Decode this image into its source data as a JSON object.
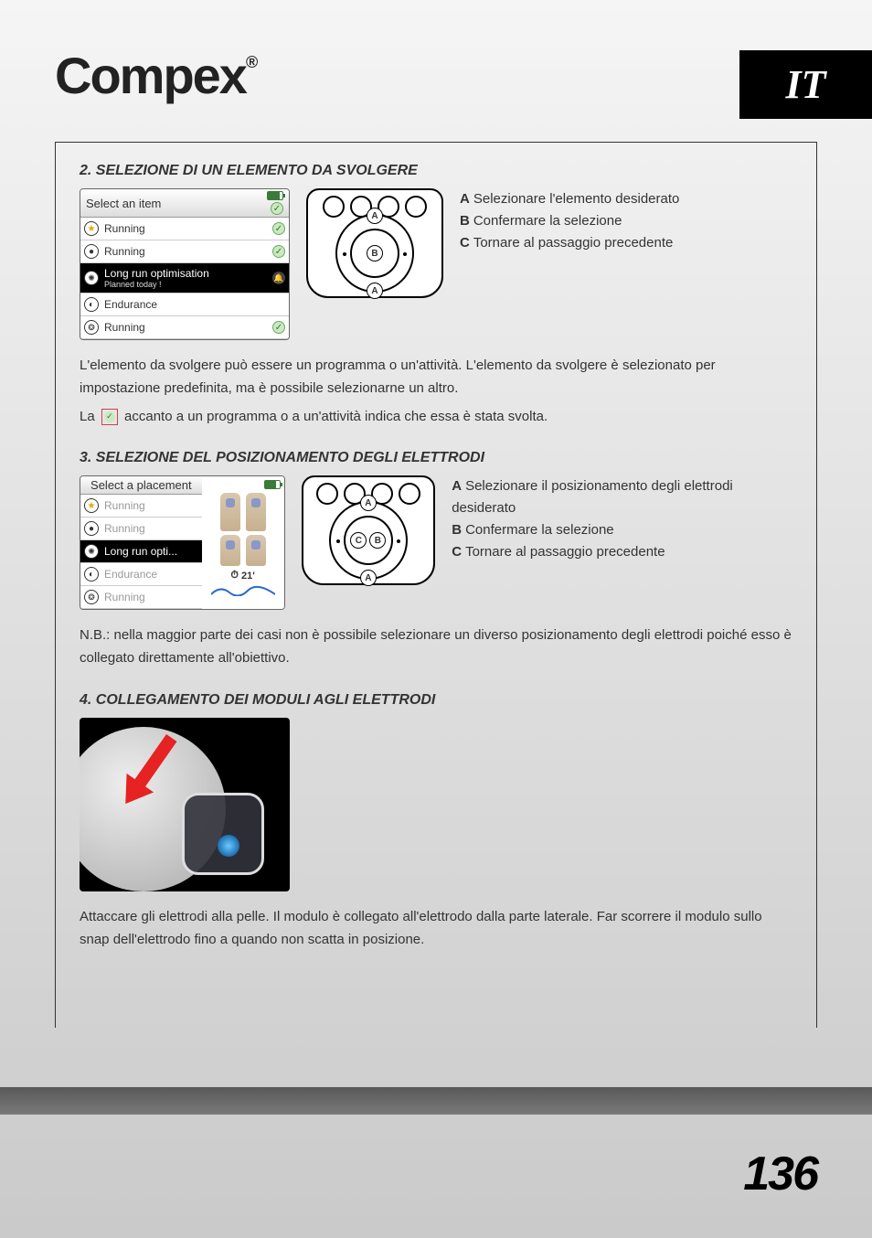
{
  "brand": "Compex",
  "registered": "®",
  "language_tab": "IT",
  "page_number": "136",
  "section2": {
    "title": "2.  SELEZIONE DI UN ELEMENTO DA SVOLGERE",
    "screen_header": "Select an item",
    "items": [
      {
        "label": "Running",
        "checked": true
      },
      {
        "label": "Running",
        "checked": true
      },
      {
        "label": "Long run optimisation",
        "sub": "Planned today !",
        "selected": true,
        "bell": true
      },
      {
        "label": "Endurance"
      },
      {
        "label": "Running",
        "checked": true
      }
    ],
    "instructions": {
      "A": "Selezionare l'elemento desiderato",
      "B": "Confermare la selezione",
      "C": "Tornare al passaggio precedente"
    },
    "para1": "L'elemento da svolgere può essere un programma o un'attività. L'elemento da svolgere è selezionato per impostazione predefinita, ma è possibile selezionarne un altro.",
    "para2_pre": "La",
    "para2_post": "accanto a un programma o a un'attività indica che essa è stata svolta."
  },
  "section3": {
    "title": "3.  SELEZIONE DEL POSIZIONAMENTO DEGLI ELETTRODI",
    "screen_header": "Select a placement",
    "items": [
      {
        "label": "Running"
      },
      {
        "label": "Running"
      },
      {
        "label": "Long run opti...",
        "selected": true
      },
      {
        "label": "Endurance"
      },
      {
        "label": "Running"
      }
    ],
    "timer": "21'",
    "instructions": {
      "A": "Selezionare il posizionamento degli elettrodi desiderato",
      "B": "Confermare la selezione",
      "C": "Tornare al passaggio precedente"
    },
    "note": "N.B.: nella maggior parte dei casi non è possibile selezionare un diverso posizionamento degli elettrodi poiché esso è collegato direttamente all'obiettivo."
  },
  "section4": {
    "title": "4.  COLLEGAMENTO DEI MODULI AGLI ELETTRODI",
    "para": "Attaccare gli elettrodi alla pelle. Il modulo è collegato all'elettrodo dalla parte laterale. Far scorrere il modulo sullo snap dell'elettrodo fino a quando non scatta in posizione."
  }
}
